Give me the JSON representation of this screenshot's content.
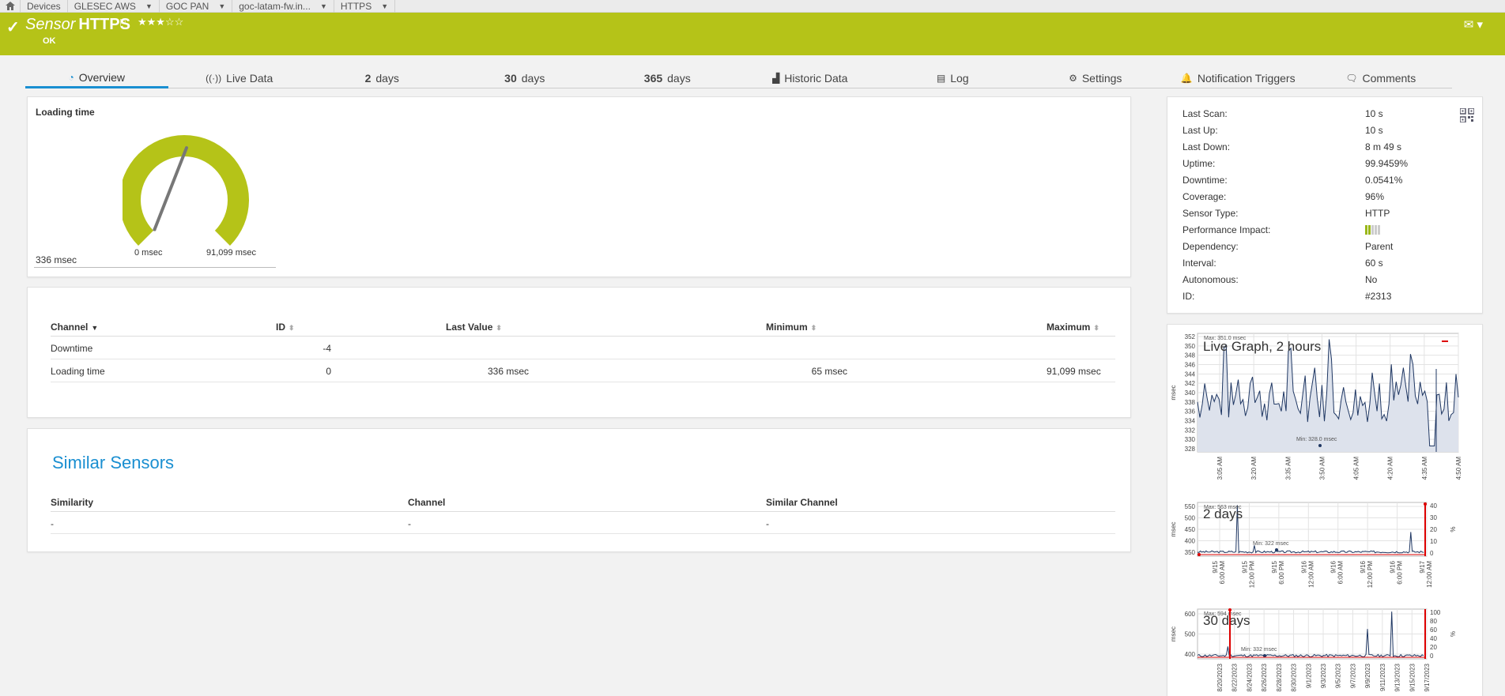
{
  "breadcrumb": {
    "items": [
      {
        "label": "Devices",
        "caret": false
      },
      {
        "label": "GLESEC AWS",
        "caret": true
      },
      {
        "label": "GOC PAN",
        "caret": true
      },
      {
        "label": "goc-latam-fw.in...",
        "caret": true
      },
      {
        "label": "HTTPS",
        "caret": true
      }
    ]
  },
  "header": {
    "title_prefix": "Sensor",
    "title_name": "HTTPS",
    "stars": "★★★☆☆",
    "status": "OK",
    "mail_icon": "✉ ▾",
    "color": "#b5c318"
  },
  "tabs": [
    {
      "icon": "◔",
      "pre": "",
      "label": "Overview",
      "active": true
    },
    {
      "icon": "((·))",
      "pre": "",
      "label": "Live Data"
    },
    {
      "icon": "",
      "pre": "2",
      "label": "days"
    },
    {
      "icon": "",
      "pre": "30",
      "label": "days"
    },
    {
      "icon": "",
      "pre": "365",
      "label": "days"
    },
    {
      "icon": "▟",
      "pre": "",
      "label": "Historic Data"
    },
    {
      "icon": "▤",
      "pre": "",
      "label": "Log"
    },
    {
      "icon": "⚙",
      "pre": "",
      "label": "Settings"
    },
    {
      "icon": "🔔",
      "pre": "",
      "label": "Notification Triggers"
    },
    {
      "icon": "🗨",
      "pre": "",
      "label": "Comments"
    }
  ],
  "gauge": {
    "title": "Loading time",
    "min_label": "0 msec",
    "max_label": "91,099 msec",
    "value_label": "336 msec",
    "min": 0,
    "max": 91099,
    "value": 336,
    "color": "#b5c318"
  },
  "channels": {
    "headers": {
      "channel": "Channel",
      "id": "ID",
      "last_value": "Last Value",
      "minimum": "Minimum",
      "maximum": "Maximum"
    },
    "rows": [
      {
        "channel": "Downtime",
        "id": "-4",
        "last_value": "",
        "minimum": "",
        "maximum": ""
      },
      {
        "channel": "Loading time",
        "id": "0",
        "last_value": "336 msec",
        "minimum": "65 msec",
        "maximum": "91,099 msec"
      }
    ]
  },
  "similar": {
    "title": "Similar Sensors",
    "headers": {
      "similarity": "Similarity",
      "channel": "Channel",
      "similar_channel": "Similar Channel"
    },
    "rows": [
      {
        "similarity": "-",
        "channel": "-",
        "similar_channel": "-"
      }
    ]
  },
  "info": {
    "rows": [
      {
        "label": "Last Scan:",
        "value": "10 s"
      },
      {
        "label": "Last Up:",
        "value": "10 s"
      },
      {
        "label": "Last Down:",
        "value": "8 m 49 s"
      },
      {
        "label": "Uptime:",
        "value": "99.9459%"
      },
      {
        "label": "Downtime:",
        "value": "0.0541%"
      },
      {
        "label": "Coverage:",
        "value": "96%"
      },
      {
        "label": "Sensor Type:",
        "value": "HTTP"
      },
      {
        "label": "Performance Impact:",
        "value": ""
      },
      {
        "label": "Dependency:",
        "value": "Parent"
      },
      {
        "label": "Interval:",
        "value": "60 s"
      },
      {
        "label": "Autonomous:",
        "value": "No"
      },
      {
        "label": "ID:",
        "value": "#2313"
      }
    ],
    "performance_impact_level": 2,
    "performance_impact_max": 5
  },
  "graphs": {
    "live": {
      "title": "Live Graph, 2 hours",
      "ylabel": "msec",
      "yticks": [
        "352",
        "350",
        "348",
        "346",
        "344",
        "342",
        "340",
        "338",
        "336",
        "334",
        "332",
        "330",
        "328"
      ],
      "xticks": [
        "3:05 AM",
        "3:20 AM",
        "3:35 AM",
        "3:50 AM",
        "4:05 AM",
        "4:20 AM",
        "4:35 AM",
        "4:50 AM"
      ],
      "max_label": "Max: 351.0 msec",
      "min_label": "Min: 328.0 msec"
    },
    "days2": {
      "title": "2 days",
      "ylabel": "msec",
      "yticks": [
        "550",
        "500",
        "450",
        "400",
        "350"
      ],
      "y2ticks": [
        "40",
        "30",
        "20",
        "10",
        "0"
      ],
      "y2label": "%",
      "xticks": [
        "9/15 6:00 AM",
        "9/15 12:00 PM",
        "9/15 6:00 PM",
        "9/16 12:00 AM",
        "9/16 6:00 AM",
        "9/16 12:00 PM",
        "9/16 6:00 PM",
        "9/17 12:00 AM"
      ],
      "max_label": "Max: 563 msec",
      "min_label": "Min: 322 msec"
    },
    "days30": {
      "title": "30 days",
      "ylabel": "msec",
      "yticks": [
        "600",
        "500",
        "400"
      ],
      "y2ticks": [
        "100",
        "80",
        "60",
        "40",
        "20",
        "0"
      ],
      "y2label": "%",
      "xticks": [
        "8/20/2023",
        "8/22/2023",
        "8/24/2023",
        "8/26/2023",
        "8/28/2023",
        "8/30/2023",
        "9/1/2023",
        "9/3/2023",
        "9/5/2023",
        "9/7/2023",
        "9/9/2023",
        "9/11/2023",
        "9/13/2023",
        "9/15/2023",
        "9/17/2023"
      ],
      "max_label": "Max: 594 msec",
      "min_label": "Min: 332 msec"
    }
  }
}
